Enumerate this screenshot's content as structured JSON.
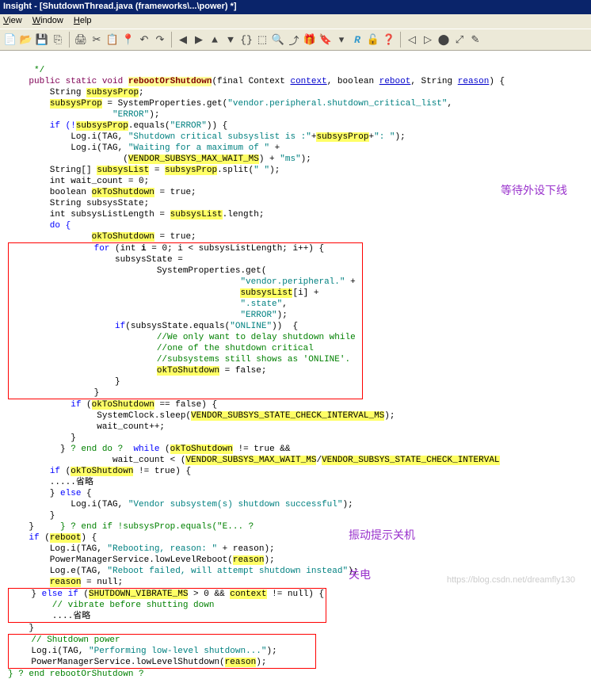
{
  "title": "Insight - [ShutdownThread.java (frameworks\\...\\power) *]",
  "menu": {
    "view": "View",
    "window": "Window",
    "help": "Help"
  },
  "toolbar_icons": [
    "📄",
    "📂",
    "💾",
    "⎘",
    "|",
    "🖨",
    "✂",
    "📋",
    "📍",
    "↶",
    "↷",
    "|",
    "⬅",
    "➡",
    "⬆",
    "⬇",
    "{}",
    "⬚",
    "🔍",
    "⤴",
    "🎁",
    "🔖",
    "▾",
    "R",
    "🔓",
    "❓",
    "|",
    "◀",
    "▶",
    "🔘",
    "⤢",
    "✎"
  ],
  "annotations": {
    "wait_ext": "等待外设下线",
    "vibrate": "振动提示关机",
    "shutdown": "关电"
  },
  "watermark": "https://blog.csdn.net/dreamfly130",
  "code": {
    "l1": "*/",
    "l2a": "public static void ",
    "l2b": "rebootOrShutdown",
    "l2c": "(final Context ",
    "l2d": "context",
    "l2e": ", boolean ",
    "l2f": "reboot",
    "l2g": ", String ",
    "l2h": "reason",
    "l2i": ") {",
    "l3": "    String ",
    "l3b": "subsysProp",
    "l3c": ";",
    "l4a": "    ",
    "l4b": "subsysProp",
    "l4c": " = SystemProperties.get(",
    "l4d": "\"vendor.peripheral.shutdown_critical_list\"",
    "l4e": ",",
    "l5a": "                    ",
    "l5b": "\"ERROR\"",
    "l5c": ");",
    "l6a": "    if (!",
    "l6b": "subsysProp",
    "l6c": ".equals(",
    "l6d": "\"ERROR\"",
    "l6e": ")) {",
    "l7a": "            Log.i(TAG, ",
    "l7b": "\"Shutdown critical subsyslist is :\"",
    "l7c": "+",
    "l7d": "subsysProp",
    "l7e": "+",
    "l7f": "\": \"",
    "l7g": ");",
    "l8a": "            Log.i(TAG, ",
    "l8b": "\"Waiting for a maximum of \"",
    "l8c": " +",
    "l9a": "                      (",
    "l9b": "VENDOR_SUBSYS_MAX_WAIT_MS",
    "l9c": ") + ",
    "l9d": "\"ms\"",
    "l9e": ");",
    "l10a": "        String[] ",
    "l10b": "subsysList",
    "l10c": " = ",
    "l10d": "subsysProp",
    "l10e": ".split(",
    "l10f": "\" \"",
    "l10g": ");",
    "l11a": "        int wait_count = ",
    "l11b": "0",
    "l11c": ";",
    "l12a": "        boolean ",
    "l12b": "okToShutdown",
    "l12c": " = true;",
    "l13": "        String subsysState;",
    "l14a": "        int subsysListLength = ",
    "l14b": "subsysList",
    "l14c": ".length;",
    "l15": "        do {",
    "l16a": "                for (int i = ",
    "l16b": "0",
    "l16c": "; i < subsysListLength; i++) {",
    "l17": "                    subsysState =",
    "l18": "                            SystemProperties.get(",
    "l19a": "                                            ",
    "l19b": "\"vendor.peripheral.\"",
    "l19c": " +",
    "l20a": "                                            ",
    "l20b": "subsysList",
    "l20c": "[i] +",
    "l21a": "                                            ",
    "l21b": "\".state\"",
    "l21c": ",",
    "l22a": "                                            ",
    "l22b": "\"ERROR\"",
    "l22c": ");",
    "l23a": "                    if(subsysState.equals(",
    "l23b": "\"ONLINE\"",
    "l23c": "))  {",
    "l24": "                            //We only want to delay shutdown while",
    "l25": "                            //one of the shutdown critical",
    "l26": "                            //subsystems still shows as 'ONLINE'.",
    "l27a": "                            ",
    "l27b": "okToShutdown",
    "l27c": " = false;",
    "l28": "                    }",
    "l29": "                }",
    "l30a": "            if (",
    "l30b": "okToShutdown",
    "l30c": " == false) {",
    "l31a": "                 SystemClock.sleep(",
    "l31b": "VENDOR_SUBSYS_STATE_CHECK_INTERVAL_MS",
    "l31c": ");",
    "l32": "                 wait_count++;",
    "l33": "            }",
    "l34a": "          } ? end do ?  while (",
    "l34b": "okToShutdown",
    "l34c": " != true &&",
    "l35a": "                    wait_count < (",
    "l35b": "VENDOR_SUBSYS_MAX_WAIT_MS",
    "l35c": "/",
    "l35d": "VENDOR_SUBSYS_STATE_CHECK_INTERVAL",
    "l36a": "        if (",
    "l36b": "okToShutdown",
    "l36c": " != true) {",
    "l37": "        .....省略",
    "l38": "        } else {",
    "l39a": "            Log.i(TAG, ",
    "l39b": "\"Vendor subsystem(s) shutdown successful\"",
    "l39c": ");",
    "l40": "        }",
    "l41": "    } ? end if !subsysProp.equals(\"E... ?",
    "l42a": "    if (",
    "l42b": "reboot",
    "l42c": ") {",
    "l43a": "        Log.i(TAG, ",
    "l43b": "\"Rebooting, reason: \"",
    "l43c": " + reason);",
    "l44a": "        PowerManagerService.lowLevelReboot(",
    "l44b": "reason",
    "l44c": ");",
    "l45a": "        Log.e(TAG, ",
    "l45b": "\"Reboot failed, will attempt shutdown instead\"",
    "l45c": ");",
    "l46a": "        ",
    "l46b": "reason",
    "l46c": " = null;",
    "l47a": "    } else if (",
    "l47b": "SHUTDOWN_VIBRATE_MS",
    "l47c": " > ",
    "l47d": "0",
    "l47e": " && ",
    "l47f": "context",
    "l47g": " != null) {",
    "l48": "        // vibrate before shutting down",
    "l49": "        ....省略",
    "l50": "    }",
    "l51": "    // Shutdown power",
    "l52a": "    Log.i(TAG, ",
    "l52b": "\"Performing low-level shutdown...\"",
    "l52c": ");",
    "l53a": "    PowerManagerService.lowLevelShutdown(",
    "l53b": "reason",
    "l53c": ");",
    "l54": "} ? end rebootOrShutdown ?",
    "okTrue": "                ",
    "okTrue2": "okToShutdown",
    "okTrue3": " = true;"
  }
}
